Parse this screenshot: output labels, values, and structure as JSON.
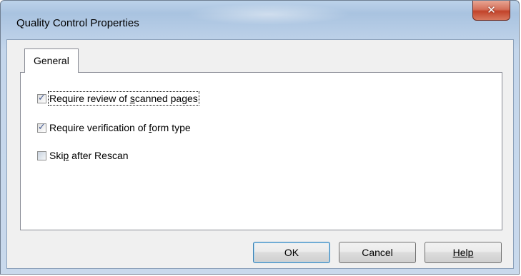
{
  "window": {
    "title": "Quality Control Properties",
    "close_glyph": "✕"
  },
  "tabs": [
    {
      "label": "General",
      "selected": true
    }
  ],
  "options": [
    {
      "label": "Require review of scanned pages",
      "checked": true,
      "accelerator": "s"
    },
    {
      "label": "Require verification of form type",
      "checked": true,
      "accelerator": "f"
    },
    {
      "label": "Skip after Rescan",
      "checked": false,
      "accelerator": "p"
    }
  ],
  "buttons": {
    "ok": "OK",
    "cancel": "Cancel",
    "help": "Help"
  },
  "icons": {
    "check": "✓"
  },
  "colors": {
    "titlebar": "#a9c3e0",
    "close_button": "#c2432a",
    "dialog_background": "#f0f0f0",
    "check_mark": "#4a5f97"
  }
}
